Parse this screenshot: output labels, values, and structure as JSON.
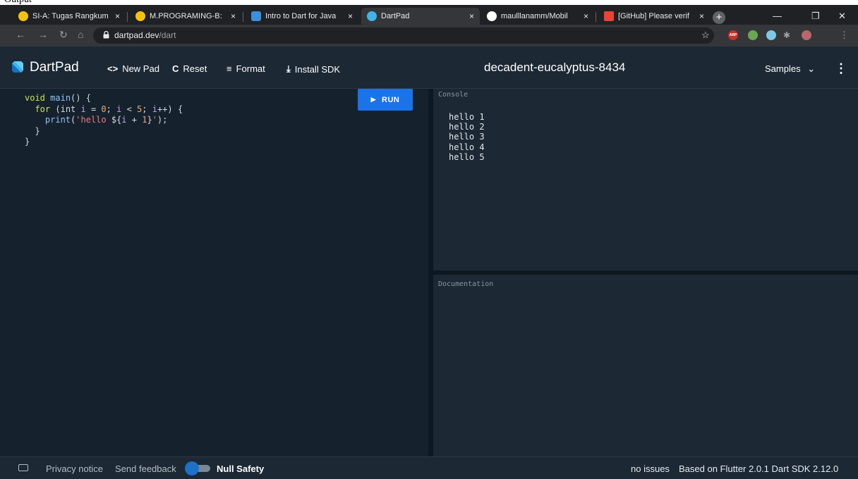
{
  "page_top_text": "Output",
  "browser": {
    "tabs": [
      {
        "title": "SI-A: Tugas Rangkum",
        "fav_color": "#f4c20d"
      },
      {
        "title": "M.PROGRAMING-B:",
        "fav_color": "#f4c20d"
      },
      {
        "title": "Intro to Dart for Java",
        "fav_color": "#3c8fd9"
      },
      {
        "title": "DartPad",
        "fav_color": "#41b3e8"
      },
      {
        "title": "maulllanamm/Mobil",
        "fav_color": "#ffffff"
      },
      {
        "title": "[GitHub] Please verif",
        "fav_color": "#ea4335"
      }
    ],
    "close_glyph": "×",
    "new_tab": "+",
    "minimize": "—",
    "restore": "❐",
    "close_window": "✕",
    "url_host": "dartpad.dev",
    "url_path": "/dart",
    "star": "☆",
    "ext_abp": "ABP"
  },
  "header": {
    "title": "DartPad",
    "new_pad": "New Pad",
    "new_pad_icon": "<>",
    "reset": "Reset",
    "reset_icon": "C",
    "format": "Format",
    "format_icon": "≡",
    "install_sdk": "Install SDK",
    "install_icon": "⤓",
    "pad_name": "decadent-eucalyptus-8434",
    "samples": "Samples",
    "samples_caret": "⌄",
    "more": "⋮"
  },
  "editor": {
    "run_label": "RUN",
    "run_icon": "▶",
    "code": {
      "l1_kw": "void",
      "l1_fn": "main",
      "l1_rest": "() {",
      "l2_kw": "for",
      "l2_a": " (int ",
      "l2_i1": "i",
      "l2_b": " = ",
      "l2_n0": "0",
      "l2_c": "; ",
      "l2_i2": "i",
      "l2_d": " < ",
      "l2_n5": "5",
      "l2_e": "; ",
      "l2_i3": "i",
      "l2_f": "++) {",
      "l3_fn": "print",
      "l3_a": "(",
      "l3_str": "'hello ",
      "l3_interp_open": "${",
      "l3_i": "i",
      "l3_plus": " + ",
      "l3_n1": "1",
      "l3_interp_close": "}",
      "l3_str_end": "'",
      "l3_end": ");",
      "l4": "}",
      "l5": "}"
    }
  },
  "console": {
    "label": "Console",
    "lines": [
      "hello 1",
      "hello 2",
      "hello 3",
      "hello 4",
      "hello 5"
    ]
  },
  "docs": {
    "label": "Documentation"
  },
  "footer": {
    "privacy": "Privacy notice",
    "feedback": "Send feedback",
    "null_safety": "Null Safety",
    "status": "no issues",
    "version": "Based on Flutter 2.0.1 Dart SDK 2.12.0"
  }
}
